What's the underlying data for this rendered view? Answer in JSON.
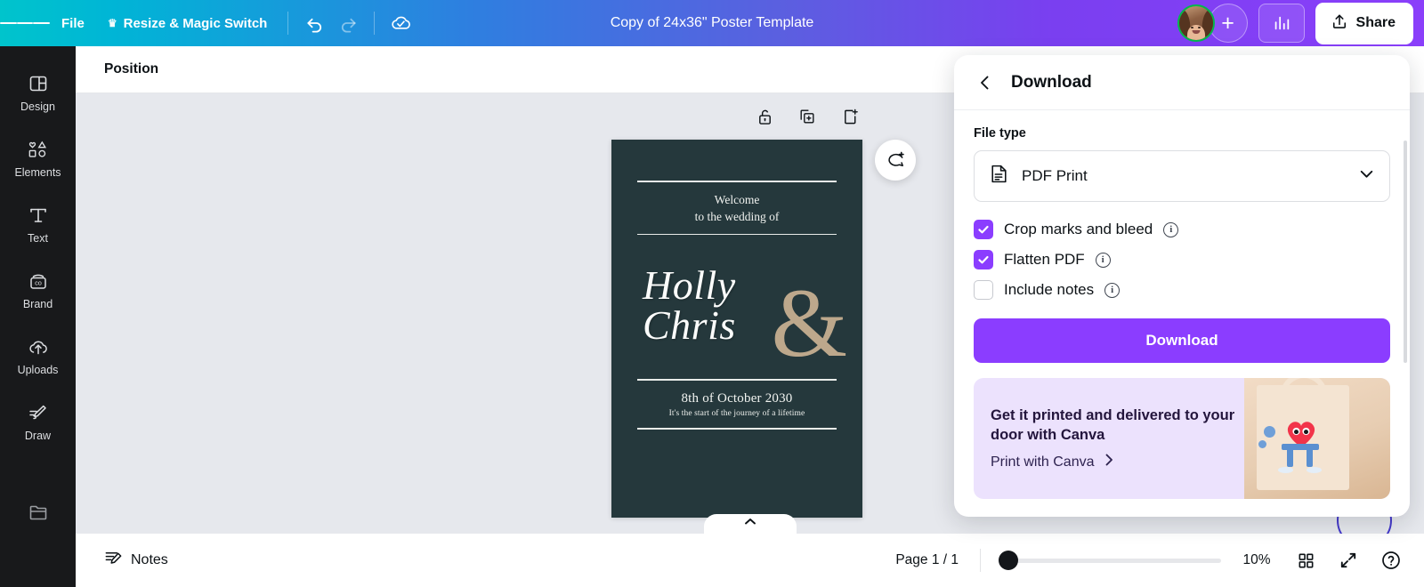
{
  "topbar": {
    "menu_icon": "hamburger-icon",
    "file_label": "File",
    "resize_label": "Resize & Magic Switch",
    "crown_icon": "crown-icon",
    "undo_icon": "undo-icon",
    "redo_icon": "redo-icon",
    "cloud_icon": "cloud-saved-icon",
    "doc_title": "Copy of 24x36\" Poster Template",
    "add_person_label": "+",
    "insights_icon": "bar-chart-icon",
    "share_label": "Share",
    "share_icon": "share-upload-icon",
    "gradient_start": "#00c4cc",
    "gradient_end": "#8a3ffa"
  },
  "sidebar": {
    "items": [
      {
        "label": "Design",
        "icon": "design-layout-icon"
      },
      {
        "label": "Elements",
        "icon": "shapes-icon"
      },
      {
        "label": "Text",
        "icon": "text-t-icon"
      },
      {
        "label": "Brand",
        "icon": "brand-kit-icon"
      },
      {
        "label": "Uploads",
        "icon": "upload-cloud-icon"
      },
      {
        "label": "Draw",
        "icon": "pencil-draw-icon"
      },
      {
        "label": "",
        "icon": "folder-projects-icon"
      }
    ]
  },
  "toolbar": {
    "position_label": "Position"
  },
  "canvas": {
    "object_icons": [
      {
        "name": "unlock-icon"
      },
      {
        "name": "duplicate-page-icon"
      },
      {
        "name": "add-page-icon"
      }
    ],
    "comment_icon": "add-comment-icon",
    "collapse_icon": "chevron-up-icon",
    "background": "#e6e8ed"
  },
  "poster": {
    "background": "#25383c",
    "accent_color": "#bda88c",
    "welcome_line1": "Welcome",
    "welcome_line2": "to the wedding of",
    "name1": "Holly",
    "name2": "Chris",
    "ampersand": "&",
    "date": "8th of October 2030",
    "tagline": "It's the start of the journey of a lifetime"
  },
  "bottombar": {
    "notes_label": "Notes",
    "notes_icon": "notes-edit-icon",
    "page_indicator": "Page 1 / 1",
    "zoom_percent": "10%",
    "grid_icon": "grid-view-icon",
    "fullscreen_icon": "expand-fullscreen-icon",
    "help_icon": "help-question-icon"
  },
  "download_panel": {
    "back_icon": "chevron-left-icon",
    "title": "Download",
    "file_type_label": "File type",
    "file_type_value": "PDF Print",
    "file_type_icon": "pdf-document-icon",
    "dropdown_icon": "chevron-down-icon",
    "options": [
      {
        "label": "Crop marks and bleed",
        "checked": true,
        "info_icon": "info-icon"
      },
      {
        "label": "Flatten PDF",
        "checked": true,
        "info_icon": "info-icon"
      },
      {
        "label": "Include notes",
        "checked": false,
        "info_icon": "info-icon"
      }
    ],
    "download_button": "Download",
    "accent_color": "#8b3dff",
    "promo": {
      "heading_line1": "Get it printed and delivered to your",
      "heading_line2": "door with Canva",
      "link_label": "Print with Canva",
      "link_icon": "chevron-right-icon",
      "background": "#ece2fd"
    }
  }
}
